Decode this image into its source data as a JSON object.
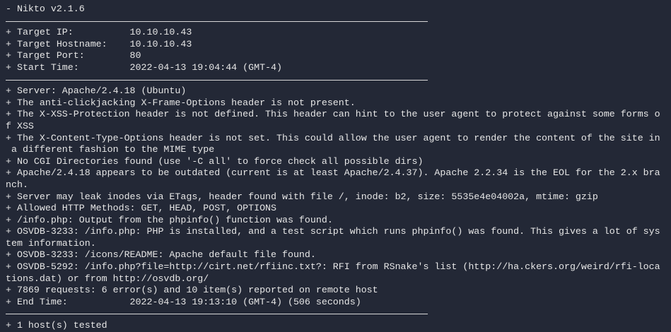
{
  "terminal": {
    "lines": [
      {
        "type": "text",
        "text": "- Nikto v2.1.6"
      },
      {
        "type": "sep"
      },
      {
        "type": "text",
        "text": "+ Target IP:          10.10.10.43"
      },
      {
        "type": "text",
        "text": "+ Target Hostname:    10.10.10.43"
      },
      {
        "type": "text",
        "text": "+ Target Port:        80"
      },
      {
        "type": "text",
        "text": "+ Start Time:         2022-04-13 19:04:44 (GMT-4)"
      },
      {
        "type": "sep"
      },
      {
        "type": "text",
        "text": "+ Server: Apache/2.4.18 (Ubuntu)"
      },
      {
        "type": "text",
        "text": "+ The anti-clickjacking X-Frame-Options header is not present."
      },
      {
        "type": "text",
        "text": "+ The X-XSS-Protection header is not defined. This header can hint to the user agent to protect against some forms o"
      },
      {
        "type": "text",
        "text": "f XSS"
      },
      {
        "type": "text",
        "text": "+ The X-Content-Type-Options header is not set. This could allow the user agent to render the content of the site in"
      },
      {
        "type": "text",
        "text": " a different fashion to the MIME type"
      },
      {
        "type": "text",
        "text": "+ No CGI Directories found (use '-C all' to force check all possible dirs)"
      },
      {
        "type": "text",
        "text": "+ Apache/2.4.18 appears to be outdated (current is at least Apache/2.4.37). Apache 2.2.34 is the EOL for the 2.x bra"
      },
      {
        "type": "text",
        "text": "nch."
      },
      {
        "type": "text",
        "text": "+ Server may leak inodes via ETags, header found with file /, inode: b2, size: 5535e4e04002a, mtime: gzip"
      },
      {
        "type": "text",
        "text": "+ Allowed HTTP Methods: GET, HEAD, POST, OPTIONS"
      },
      {
        "type": "text",
        "text": "+ /info.php: Output from the phpinfo() function was found."
      },
      {
        "type": "text",
        "text": "+ OSVDB-3233: /info.php: PHP is installed, and a test script which runs phpinfo() was found. This gives a lot of sys"
      },
      {
        "type": "text",
        "text": "tem information."
      },
      {
        "type": "text",
        "text": "+ OSVDB-3233: /icons/README: Apache default file found."
      },
      {
        "type": "text",
        "text": "+ OSVDB-5292: /info.php?file=http://cirt.net/rfiinc.txt?: RFI from RSnake's list (http://ha.ckers.org/weird/rfi-loca"
      },
      {
        "type": "text",
        "text": "tions.dat) or from http://osvdb.org/"
      },
      {
        "type": "text",
        "text": "+ 7869 requests: 6 error(s) and 10 item(s) reported on remote host"
      },
      {
        "type": "text",
        "text": "+ End Time:           2022-04-13 19:13:10 (GMT-4) (506 seconds)"
      },
      {
        "type": "sep"
      },
      {
        "type": "text",
        "text": "+ 1 host(s) tested"
      }
    ]
  }
}
